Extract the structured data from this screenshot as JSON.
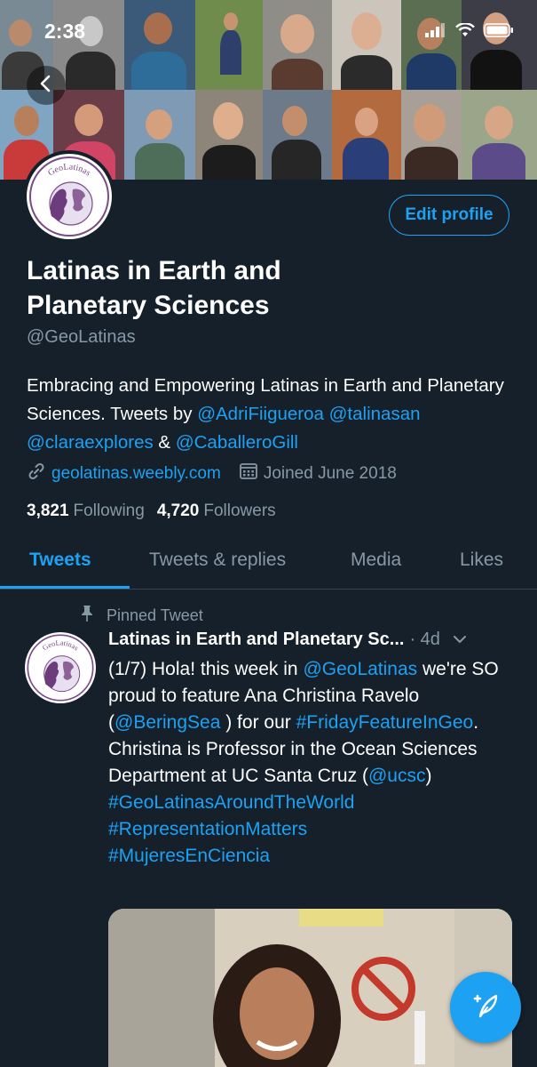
{
  "status_bar": {
    "time": "2:38"
  },
  "profile": {
    "display_name": "Latinas in Earth and Planetary Sciences",
    "handle": "@GeoLatinas",
    "avatar_logo_text": "GeoLatinas",
    "edit_profile_label": "Edit profile",
    "bio": {
      "text_1": "Embracing and Empowering Latinas in Earth and Planetary Sciences. Tweets by ",
      "mention_1": "@AdriFiigueroa",
      "mention_2": "@talinasan",
      "mention_3": "@claraexplores",
      "amp": " & ",
      "mention_4": "@CaballeroGill"
    },
    "website": "geolatinas.weebly.com",
    "joined": "Joined June 2018",
    "following_count": "3,821",
    "following_label": "Following",
    "followers_count": "4,720",
    "followers_label": "Followers"
  },
  "tabs": [
    "Tweets",
    "Tweets & replies",
    "Media",
    "Likes"
  ],
  "active_tab": "Tweets",
  "pinned_tweet": {
    "pin_label": "Pinned Tweet",
    "author": "Latinas in Earth and Planetary Sc...",
    "time": "· 4d",
    "t1": "(1/7) Hola! this week in ",
    "m1": "@GeoLatinas",
    "t2": " we're SO proud to feature Ana Christina Ravelo (",
    "m2": "@BeringSea",
    "t3": " ) for our ",
    "h1": "#FridayFeatureInGeo",
    "t4": ". Christina is Professor in the Ocean Sciences Department at UC Santa Cruz (",
    "m3": "@ucsc",
    "t5": ")",
    "h2": "#GeoLatinasAroundTheWorld",
    "h3": "#RepresentationMatters",
    "h4": "#MujeresEnCiencia"
  },
  "colors": {
    "background": "#15202b",
    "accent": "#1da1f2",
    "muted": "#8899a6",
    "divider": "#38444d"
  },
  "icons": [
    "back-arrow-icon",
    "signal-icon",
    "wifi-icon",
    "battery-icon",
    "link-icon",
    "calendar-icon",
    "pin-icon",
    "chevron-down-icon",
    "compose-icon"
  ]
}
